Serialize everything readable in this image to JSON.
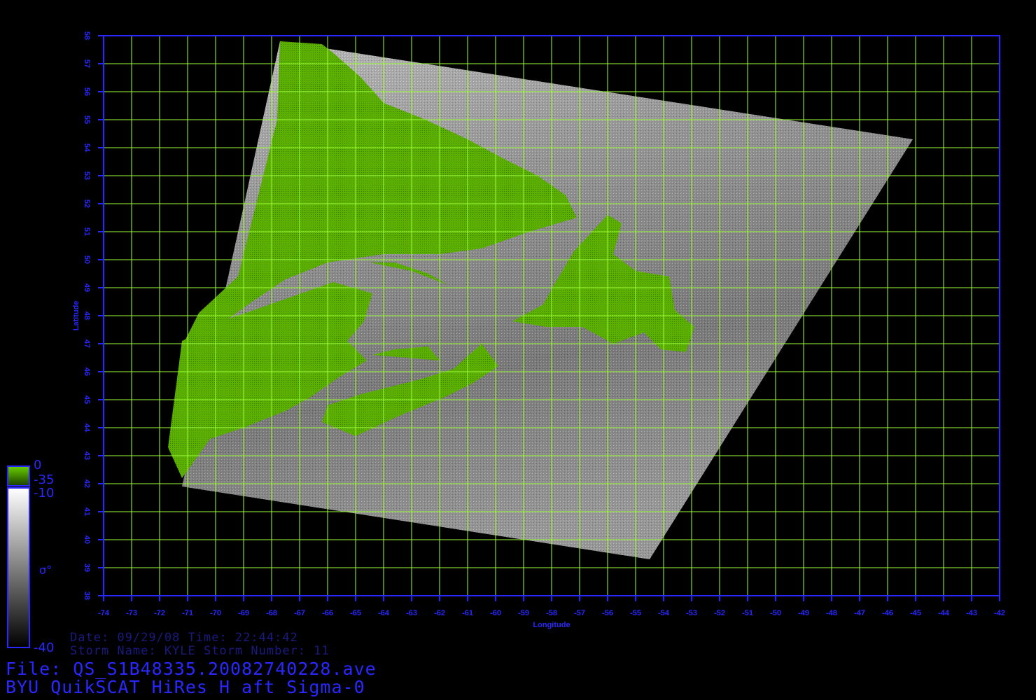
{
  "map": {
    "x_label": "Longitude",
    "y_label": "Latitude",
    "lon_ticks": [
      "-74",
      "-73",
      "-72",
      "-71",
      "-70",
      "-69",
      "-68",
      "-67",
      "-66",
      "-65",
      "-64",
      "-63",
      "-62",
      "-61",
      "-60",
      "-59",
      "-58",
      "-57",
      "-56",
      "-55",
      "-54",
      "-53",
      "-52",
      "-51",
      "-50",
      "-49",
      "-48",
      "-47",
      "-46",
      "-45",
      "-44",
      "-43",
      "-42"
    ],
    "lat_ticks": [
      "38",
      "39",
      "40",
      "41",
      "42",
      "43",
      "44",
      "45",
      "46",
      "47",
      "48",
      "49",
      "50",
      "51",
      "52",
      "53",
      "54",
      "55",
      "56",
      "57",
      "58"
    ],
    "lon_range": [
      -74,
      -42
    ],
    "lat_range": [
      38,
      58
    ],
    "grid_color": "#9cff3c",
    "frame_color": "#2828ff",
    "land_color": "#5aaa00",
    "swath_corners": [
      {
        "lon": -67.7,
        "lat": 57.8
      },
      {
        "lon": -45.1,
        "lat": 54.3
      },
      {
        "lon": -54.5,
        "lat": 39.3
      },
      {
        "lon": -71.2,
        "lat": 41.9
      }
    ]
  },
  "colorbar": {
    "land_top": "0",
    "land_bottom": "-35",
    "ocean_top": "-10",
    "ocean_bottom": "-40",
    "symbol": "σ°"
  },
  "info": {
    "date_line": "Date: 09/29/08  Time: 22:44:42",
    "storm_line": "Storm  Name: KYLE   Storm  Number: 11",
    "file_line": "File: QS_S1B48335.20082740228.ave",
    "product_line": "BYU QuikSCAT HiRes H aft Sigma-0"
  }
}
